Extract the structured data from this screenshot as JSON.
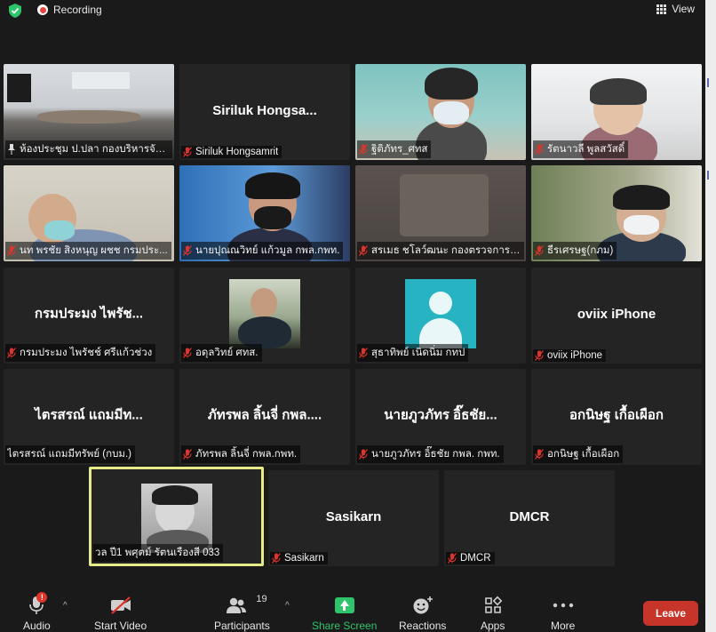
{
  "topbar": {
    "recording_label": "Recording",
    "view_label": "View"
  },
  "tiles": [
    {
      "type": "video",
      "scene": "room",
      "name": "ห้องประชุม ป.ปลา กองบริหารจัด...",
      "pinned": true
    },
    {
      "type": "text",
      "display": "Siriluk  Hongsa...",
      "name": "Siriluk Hongsamrit"
    },
    {
      "type": "video",
      "scene": "mask",
      "name": "ฐิติภัทร_ศทส"
    },
    {
      "type": "video",
      "scene": "office",
      "name": "รัตนาวลี พูลสวัสดิ์"
    },
    {
      "type": "video",
      "scene": "wall",
      "name": "นท พรชัย สิงหนุญ ผชช กรมประ..."
    },
    {
      "type": "video",
      "scene": "blue",
      "name": "นายปุณณวิทย์ แก้วมูล กพล.กพท."
    },
    {
      "type": "video",
      "scene": "dim",
      "name": "สรเมธ ชโลว์ฒนะ กองตรวจการป..."
    },
    {
      "type": "video",
      "scene": "green",
      "name": "ธีรเศรษฐ(กภม)"
    },
    {
      "type": "text",
      "display": "กรมประมง ไพรัช...",
      "name": "กรมประมง ไพรัชช์ ศรีแก้วช่วง"
    },
    {
      "type": "image",
      "image": "grad",
      "name": "อดุลวิทย์ ศทส."
    },
    {
      "type": "image",
      "image": "avatar",
      "name": "สุธาทิพย์ เนิดนิ่ม  กทป"
    },
    {
      "type": "text",
      "display": "oviix iPhone",
      "name": "oviix iPhone"
    },
    {
      "type": "text",
      "display": "ไตรสรณ์ แถมมีท...",
      "name": "ไตรสรณ์ แถมมีทรัพย์ (กบม.)",
      "mic": false
    },
    {
      "type": "text",
      "display": "ภัทรพล ลิ้นจี่ กพล....",
      "name": "ภัทรพล ลิ้นจี่ กพล.กพท."
    },
    {
      "type": "text",
      "display": "นายภูวภัทร อิ๊ธชัย...",
      "name": "นายภูวภัทร อิ๊ธชัย กพล. กพท."
    },
    {
      "type": "text",
      "display": "อกนิษฐ เกื้อเผือก",
      "name": "อกนิษฐ เกื้อเผือก"
    },
    {
      "type": "image",
      "image": "bw",
      "name": "วล ปี1 พศุตม์ รัตนเรืองสี 033",
      "active": true,
      "mic": false
    },
    {
      "type": "text",
      "display": "Sasikarn",
      "name": "Sasikarn"
    },
    {
      "type": "text",
      "display": "DMCR",
      "name": "DMCR"
    }
  ],
  "toolbar": {
    "audio_label": "Audio",
    "video_label": "Start Video",
    "participants_label": "Participants",
    "participants_count": "19",
    "share_label": "Share Screen",
    "reactions_label": "Reactions",
    "apps_label": "Apps",
    "more_label": "More",
    "leave_label": "Leave",
    "audio_badge": "!"
  },
  "colors": {
    "background": "#1a1a1a",
    "tile": "#242424",
    "share_green": "#2ec46c",
    "leave_red": "#c7342a",
    "active_border": "#e6eb8a",
    "mic_off_red": "#e0342a"
  }
}
